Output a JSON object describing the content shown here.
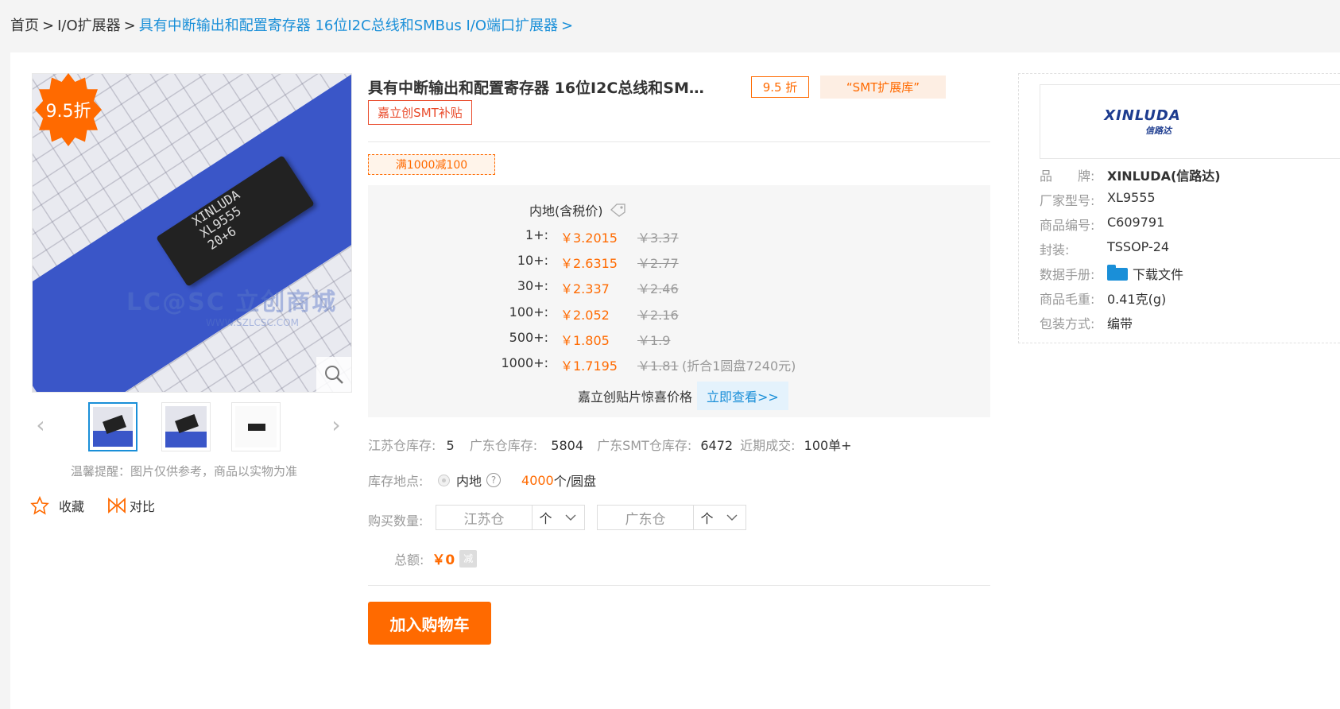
{
  "breadcrumb": {
    "items": [
      "首页",
      "I/O扩展器",
      "具有中断输出和配置寄存器 16位I2C总线和SMBus I/O端口扩展器"
    ],
    "separator": ">"
  },
  "gallery": {
    "discount_badge": "9.5折",
    "chip_marking": "XINLUDA\nXL9555\n20+6",
    "watermark": "LC@SC 立创商城",
    "watermark_url": "WWW.SZLCSC.COM",
    "photo_note": "温馨提醒：图片仅供参考，商品以实物为准",
    "favorite_label": "收藏",
    "compare_label": "对比"
  },
  "product": {
    "title": "具有中断输出和配置寄存器 16位I2C总线和SM…",
    "discount_tag": "9.5 折",
    "library_tag": "“SMT扩展库”",
    "subsidy_tag": "嘉立创SMT补贴",
    "coupon": "满1000减100"
  },
  "pricing": {
    "header": "内地(含税价)",
    "tiers": [
      {
        "qty": "1+:",
        "price": "￥3.2015",
        "original": "￥3.37",
        "note": ""
      },
      {
        "qty": "10+:",
        "price": "￥2.6315",
        "original": "￥2.77",
        "note": ""
      },
      {
        "qty": "30+:",
        "price": "￥2.337",
        "original": "￥2.46",
        "note": ""
      },
      {
        "qty": "100+:",
        "price": "￥2.052",
        "original": "￥2.16",
        "note": ""
      },
      {
        "qty": "500+:",
        "price": "￥1.805",
        "original": "￥1.9",
        "note": ""
      },
      {
        "qty": "1000+:",
        "price": "￥1.7195",
        "original": "￥1.81",
        "note": "(折合1圆盘7240元)"
      }
    ],
    "patch_label": "嘉立创贴片惊喜价格",
    "patch_link": "立即查看>>"
  },
  "stock": {
    "jiangsu_label": "江苏仓库存:",
    "jiangsu_value": "5",
    "guangdong_label": "广东仓库存:",
    "guangdong_value": "5804",
    "smt_label": "广东SMT仓库存:",
    "smt_value": "6472",
    "recent_label": "近期成交:",
    "recent_value": "100单+"
  },
  "location": {
    "label": "库存地点:",
    "option": "内地",
    "help": "?",
    "reel_qty": "4000",
    "reel_unit": "个/圆盘"
  },
  "purchase": {
    "label": "购买数量:",
    "jiangsu_placeholder": "江苏仓",
    "guangdong_placeholder": "广东仓",
    "unit": "个"
  },
  "total": {
    "label": "总额:",
    "value": "￥0",
    "badge": "减"
  },
  "cart_button": "加入购物车",
  "brand": {
    "logo_text": "XINLUDA",
    "logo_cn": "信路达",
    "specs": [
      {
        "key": "品　　牌:",
        "value": "XINLUDA(信路达)"
      },
      {
        "key": "厂家型号:",
        "value": "XL9555"
      },
      {
        "key": "商品编号:",
        "value": "C609791"
      },
      {
        "key": "封装:",
        "value": "TSSOP-24"
      },
      {
        "key": "数据手册:",
        "value": "下载文件"
      },
      {
        "key": "商品毛重:",
        "value": "0.41克(g)"
      },
      {
        "key": "包装方式:",
        "value": "编带"
      }
    ]
  },
  "colors": {
    "accent": "#ff6a00",
    "link": "#1a8fd8",
    "red": "#e94a2a"
  }
}
